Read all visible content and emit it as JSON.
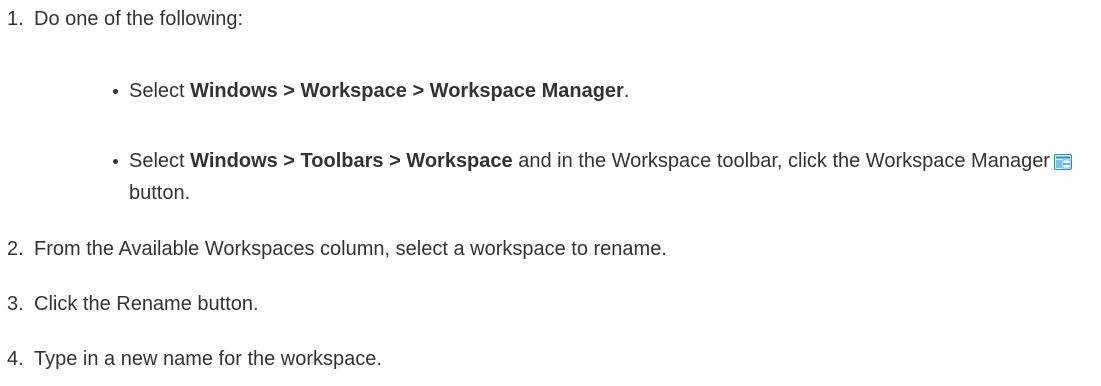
{
  "steps": [
    {
      "number": "1.",
      "text": "Do one of the following:"
    },
    {
      "number": "2.",
      "text": "From the Available Workspaces column, select a workspace to rename."
    },
    {
      "number": "3.",
      "text": "Click the Rename button."
    },
    {
      "number": "4.",
      "text": "Type in a new name for the workspace."
    }
  ],
  "bullets": {
    "first": {
      "prefix": "Select ",
      "menu_path": "Windows > Workspace > Workspace Manager",
      "suffix": "."
    },
    "second": {
      "prefix": "Select ",
      "menu_path": "Windows > Toolbars > Workspace",
      "middle": " and in the Workspace toolbar, click the Workspace Manager",
      "suffix": " button."
    }
  },
  "icons": {
    "workspace_manager": "workspace-manager-icon"
  },
  "colors": {
    "text": "#333333",
    "icon_accent": "#2a8fc7"
  }
}
